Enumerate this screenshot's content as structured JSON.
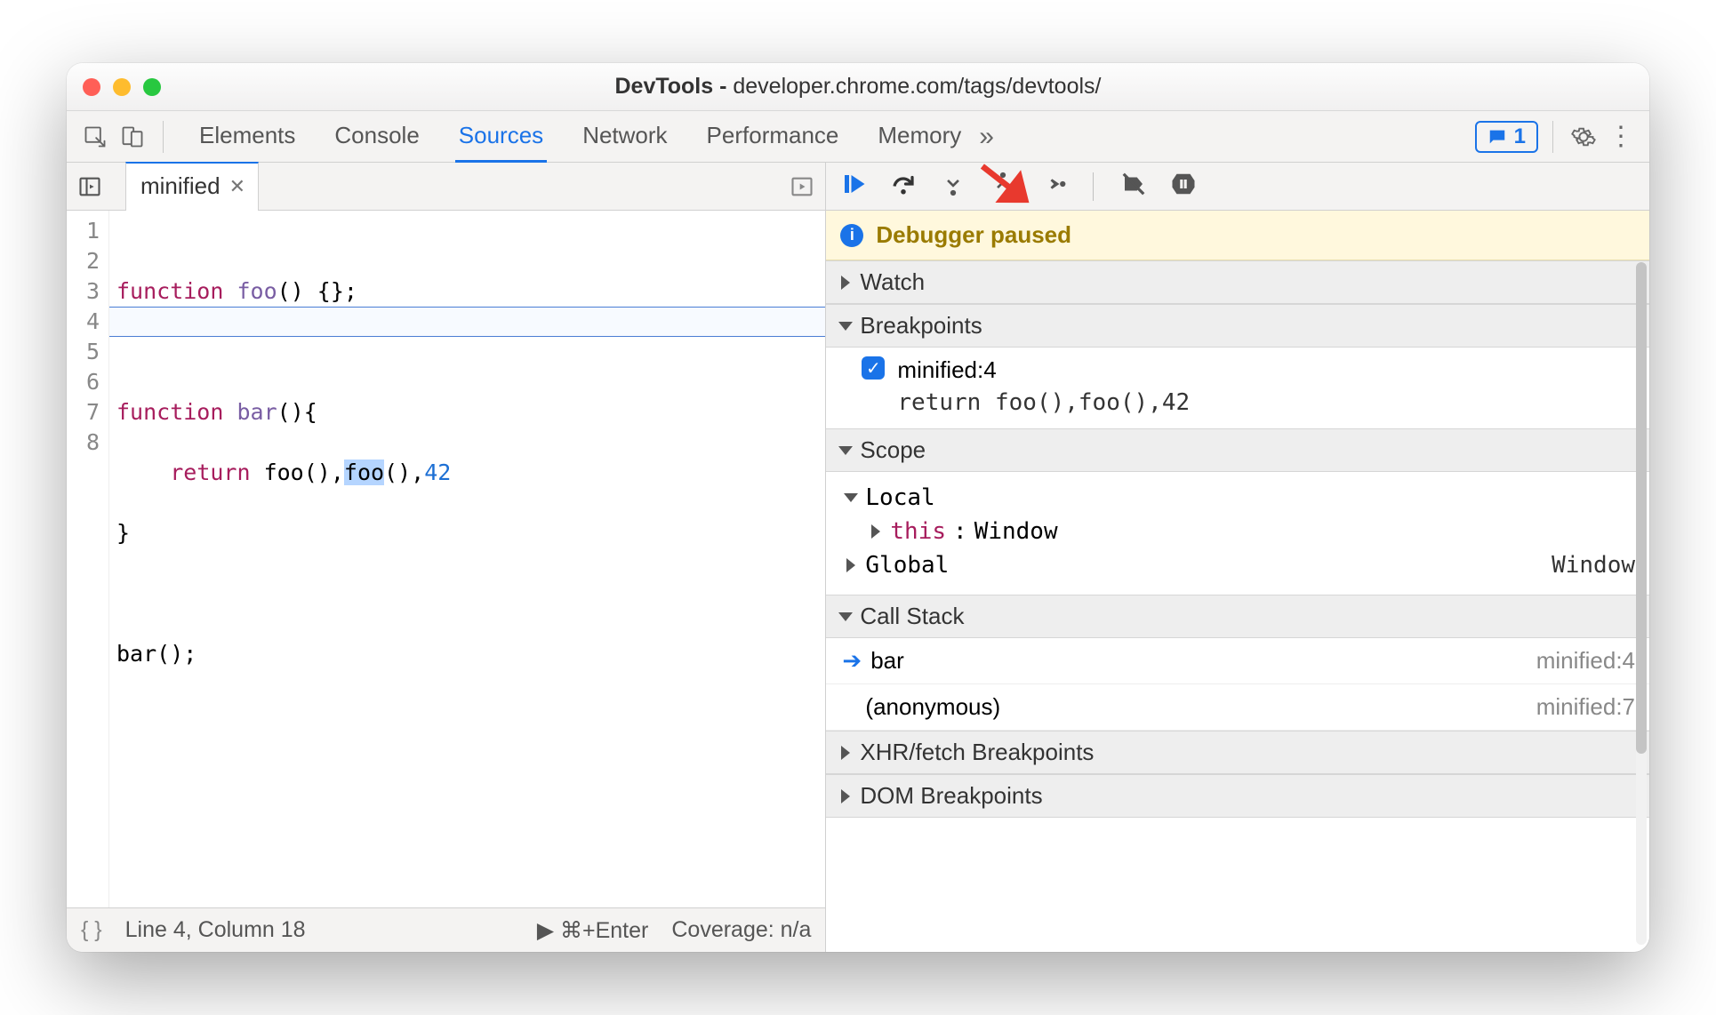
{
  "window": {
    "title_prefix": "DevTools - ",
    "title_url": "developer.chrome.com/tags/devtools/"
  },
  "toolbar": {
    "tabs": [
      "Elements",
      "Console",
      "Sources",
      "Network",
      "Performance",
      "Memory"
    ],
    "active_tab_index": 2,
    "overflow_label": "»",
    "issues_count": "1"
  },
  "editor": {
    "filename": "minified",
    "lines": {
      "l1_kw1": "function",
      "l1_fn": "foo",
      "l1_rest": "() {};",
      "l3_kw1": "function",
      "l3_fn": "bar",
      "l3_rest": "(){",
      "l4_kw": "return",
      "l4_a": " foo(),",
      "l4_sel": "foo",
      "l4_b": "(),",
      "l4_num": "42",
      "l5": "}",
      "l7": "bar();"
    },
    "line_numbers": [
      "1",
      "2",
      "3",
      "4",
      "5",
      "6",
      "7",
      "8"
    ],
    "highlighted_line_index": 3
  },
  "footer": {
    "pretty_label": "{ }",
    "cursor": "Line 4, Column 18",
    "run_hint": "⌘+Enter",
    "coverage": "Coverage: n/a"
  },
  "debugger": {
    "banner": "Debugger paused",
    "sections": {
      "watch": "Watch",
      "breakpoints": "Breakpoints",
      "scope": "Scope",
      "callstack": "Call Stack",
      "xhr": "XHR/fetch Breakpoints",
      "dom": "DOM Breakpoints"
    },
    "breakpoint": {
      "label": "minified:4",
      "code": "return foo(),foo(),42"
    },
    "scope": {
      "local_label": "Local",
      "this_label": "this",
      "this_value": "Window",
      "global_label": "Global",
      "global_value": "Window"
    },
    "callstack": [
      {
        "name": "bar",
        "src": "minified:4",
        "current": true
      },
      {
        "name": "(anonymous)",
        "src": "minified:7",
        "current": false
      }
    ]
  }
}
